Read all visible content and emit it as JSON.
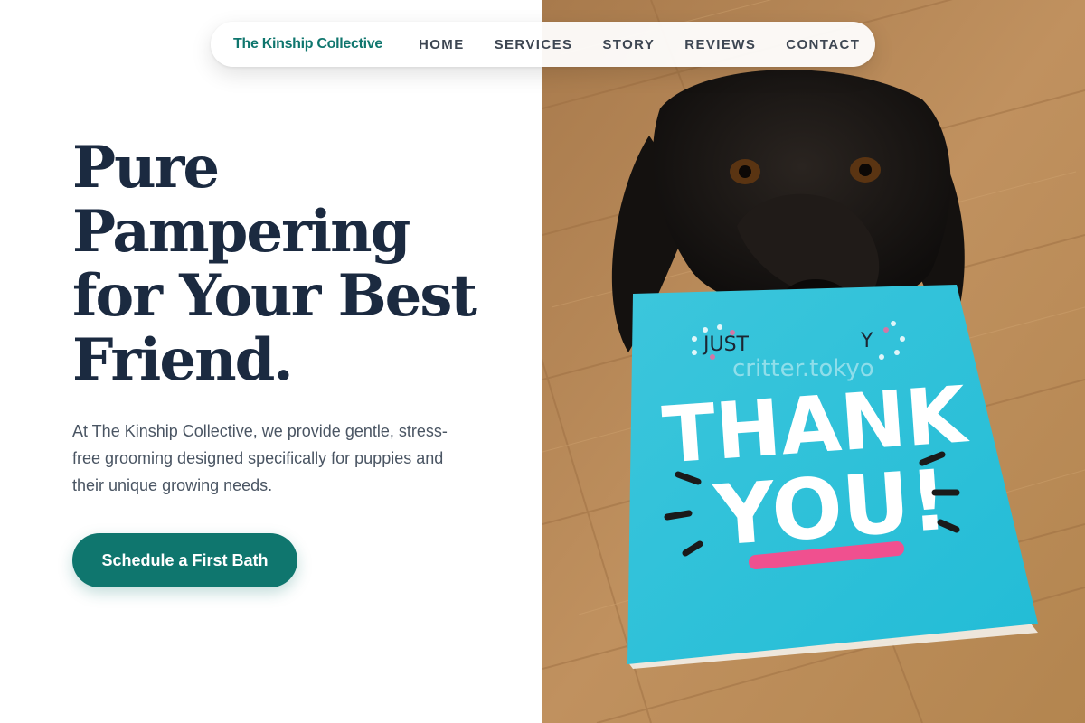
{
  "nav": {
    "brand": "The Kinship Collective",
    "links": [
      "HOME",
      "SERVICES",
      "STORY",
      "REVIEWS",
      "CONTACT"
    ]
  },
  "hero": {
    "title_lines": [
      "Pure",
      "Pampering",
      "for Your Best",
      "Friend."
    ],
    "description": "At The Kinship Collective, we provide gentle, stress-free grooming designed specifically for puppies and their unique growing needs.",
    "cta_label": "Schedule a First Bath"
  },
  "image": {
    "card_top_text": "JUST",
    "card_top_text_right": "Y",
    "card_line1": "THANK",
    "card_line2": "YOU!",
    "watermark": "critter.tokyo"
  },
  "colors": {
    "brand": "#0f766e",
    "accent": "#0f766e",
    "title": "#1b2a40",
    "body_text": "#4a5563",
    "card": "#2cc4dc",
    "floor": "#b88a5a"
  }
}
